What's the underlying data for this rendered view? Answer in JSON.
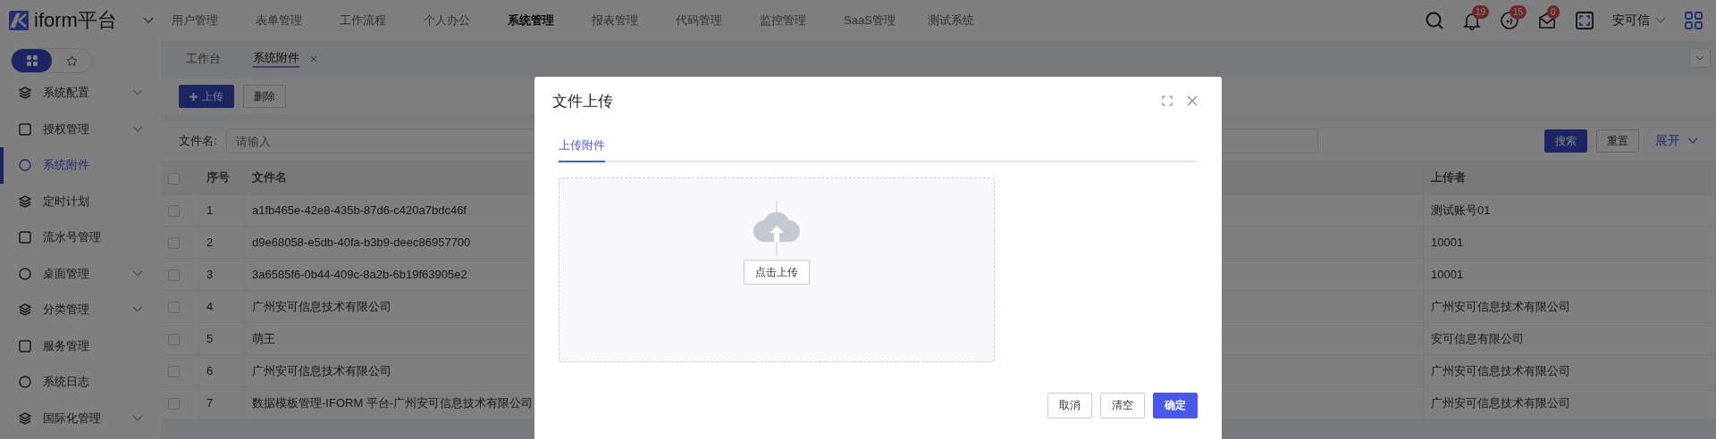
{
  "header": {
    "logo": "iform平台",
    "nav": [
      {
        "label": "用户管理",
        "selected": false
      },
      {
        "label": "表单管理",
        "selected": false
      },
      {
        "label": "工作流程",
        "selected": false
      },
      {
        "label": "个人办公",
        "selected": false
      },
      {
        "label": "系统管理",
        "selected": true
      },
      {
        "label": "报表管理",
        "selected": false
      },
      {
        "label": "代码管理",
        "selected": false
      },
      {
        "label": "监控管理",
        "selected": false
      },
      {
        "label": "SaaS管理",
        "selected": false
      },
      {
        "label": "测试系统",
        "selected": false
      }
    ],
    "badges": [
      "19",
      "15",
      "0"
    ],
    "user": "安可信"
  },
  "sidebar": {
    "view_modes": [
      {
        "selected": true
      },
      {
        "selected": false
      }
    ],
    "items": [
      {
        "label": "系统配置",
        "expandable": true,
        "selected": false
      },
      {
        "label": "授权管理",
        "expandable": true,
        "selected": false
      },
      {
        "label": "系统附件",
        "expandable": false,
        "selected": true
      },
      {
        "label": "定时计划",
        "expandable": false,
        "selected": false
      },
      {
        "label": "流水号管理",
        "expandable": false,
        "selected": false
      },
      {
        "label": "桌面管理",
        "expandable": true,
        "selected": false
      },
      {
        "label": "分类管理",
        "expandable": true,
        "selected": false
      },
      {
        "label": "服务管理",
        "expandable": false,
        "selected": false
      },
      {
        "label": "系统日志",
        "expandable": false,
        "selected": false
      },
      {
        "label": "国际化管理",
        "expandable": true,
        "selected": false
      }
    ]
  },
  "tabs": [
    {
      "label": "工作台",
      "selected": false
    },
    {
      "label": "系统附件",
      "selected": true
    }
  ],
  "toolbar": {
    "upload": "上传",
    "delete": "删除"
  },
  "search": {
    "label": "文件名:",
    "placeholder": "请输入",
    "search": "搜索",
    "reset": "重置",
    "expand": "展开"
  },
  "table": {
    "all_checked": false,
    "columns": [
      "序号",
      "文件名",
      "上传者"
    ],
    "rows": [
      {
        "checked": false,
        "index": "1",
        "name": "a1fb465e-42e8-435b-87d6-c420a7bdc46f",
        "uploader": "测试账号01"
      },
      {
        "checked": false,
        "index": "2",
        "name": "d9e68058-e5db-40fa-b3b9-deec86957700",
        "uploader": "10001"
      },
      {
        "checked": false,
        "index": "3",
        "name": "3a6585f6-0b44-409c-8a2b-6b19f63905e2",
        "uploader": "10001"
      },
      {
        "checked": false,
        "index": "4",
        "name": "广州安可信息技术有限公司",
        "uploader": "广州安可信息技术有限公司"
      },
      {
        "checked": false,
        "index": "5",
        "name": "萌王",
        "uploader": "安可信息有限公司"
      },
      {
        "checked": false,
        "index": "6",
        "name": "广州安可信息技术有限公司",
        "uploader": "广州安可信息技术有限公司"
      },
      {
        "checked": false,
        "index": "7",
        "name": "数据模板管理-IFORM 平台-广州安可信息技术有限公司",
        "uploader": "广州安可信息技术有限公司"
      }
    ]
  },
  "dialog": {
    "title": "文件上传",
    "tabs": [
      {
        "label": "上传附件",
        "selected": true
      }
    ],
    "upload_button": "点击上传",
    "buttons": [
      "取消",
      "清空",
      "确定"
    ]
  }
}
